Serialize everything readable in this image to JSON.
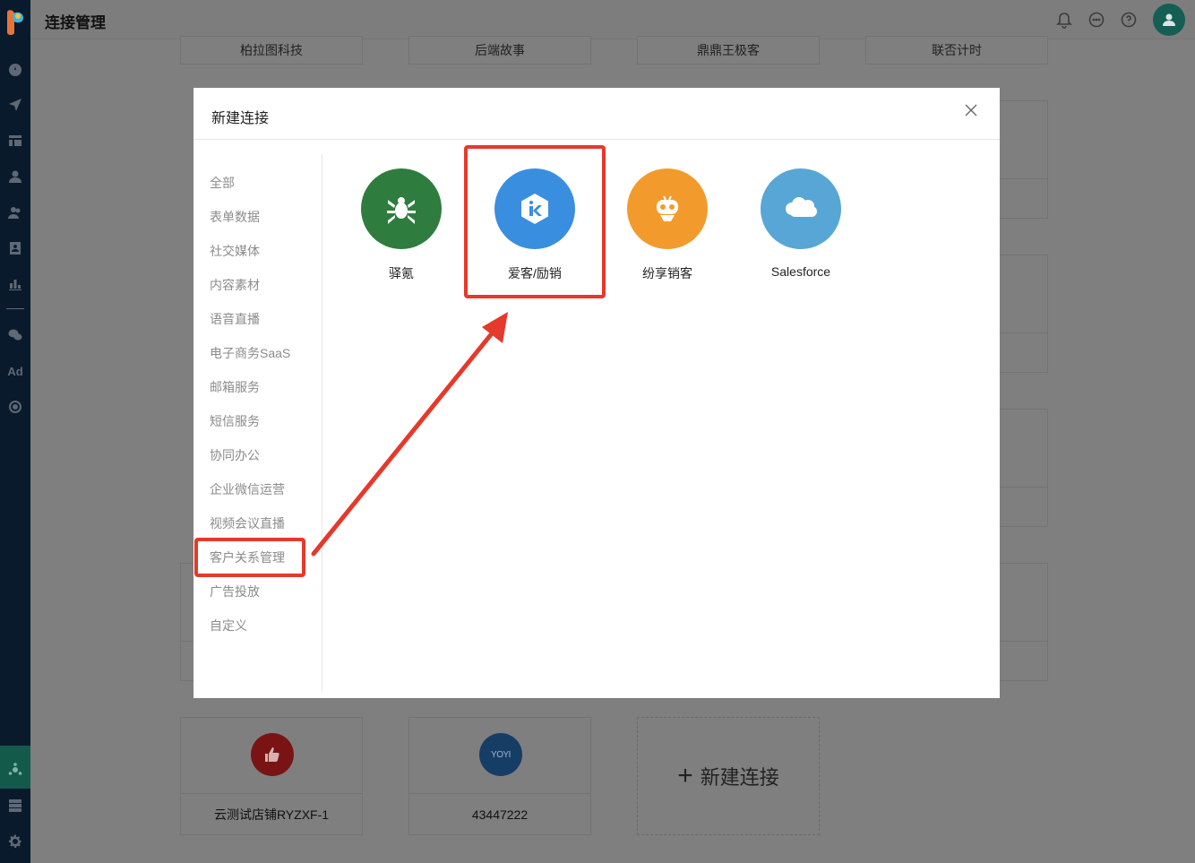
{
  "header": {
    "title": "连接管理"
  },
  "sidebar": {
    "icons": [
      "dashboard-icon",
      "send-icon",
      "layout-icon",
      "user-icon",
      "users-icon",
      "contacts-icon",
      "bar-chart-icon",
      "wechat-icon",
      "ad-icon",
      "target-icon",
      "network-icon",
      "server-icon",
      "gear-icon"
    ],
    "ad_label": "Ad"
  },
  "background": {
    "top_cards": [
      "柏拉图科技",
      "后端故事",
      "鼎鼎王极客",
      "联否计时"
    ],
    "bottom_cards": [
      {
        "name": "云测试店铺RYZXF-1",
        "icon": "thumbs-up-icon",
        "color": "#7a1414"
      },
      {
        "name": "43447222",
        "icon": "yoyi-logo-icon",
        "color": "#163d66",
        "logo_text": "YOYI"
      }
    ],
    "new_connection": "新建连接"
  },
  "modal": {
    "title": "新建连接",
    "categories": [
      "全部",
      "表单数据",
      "社交媒体",
      "内容素材",
      "语音直播",
      "电子商务SaaS",
      "邮箱服务",
      "短信服务",
      "协同办公",
      "企业微信运营",
      "视频会议直播",
      "客户关系管理",
      "广告投放",
      "自定义"
    ],
    "selected_category": "客户关系管理",
    "apps": [
      {
        "name": "驿氪",
        "color": "#2e7d3f",
        "icon": "spider-icon"
      },
      {
        "name": "爱客/励销",
        "color": "#3a8ee0",
        "icon": "ike-logo-icon"
      },
      {
        "name": "纷享销客",
        "color": "#f29b2c",
        "icon": "robot-icon"
      },
      {
        "name": "Salesforce",
        "color": "#58a6d6",
        "icon": "cloud-icon"
      }
    ]
  },
  "annotation": {
    "highlight_color": "#e5392b"
  }
}
